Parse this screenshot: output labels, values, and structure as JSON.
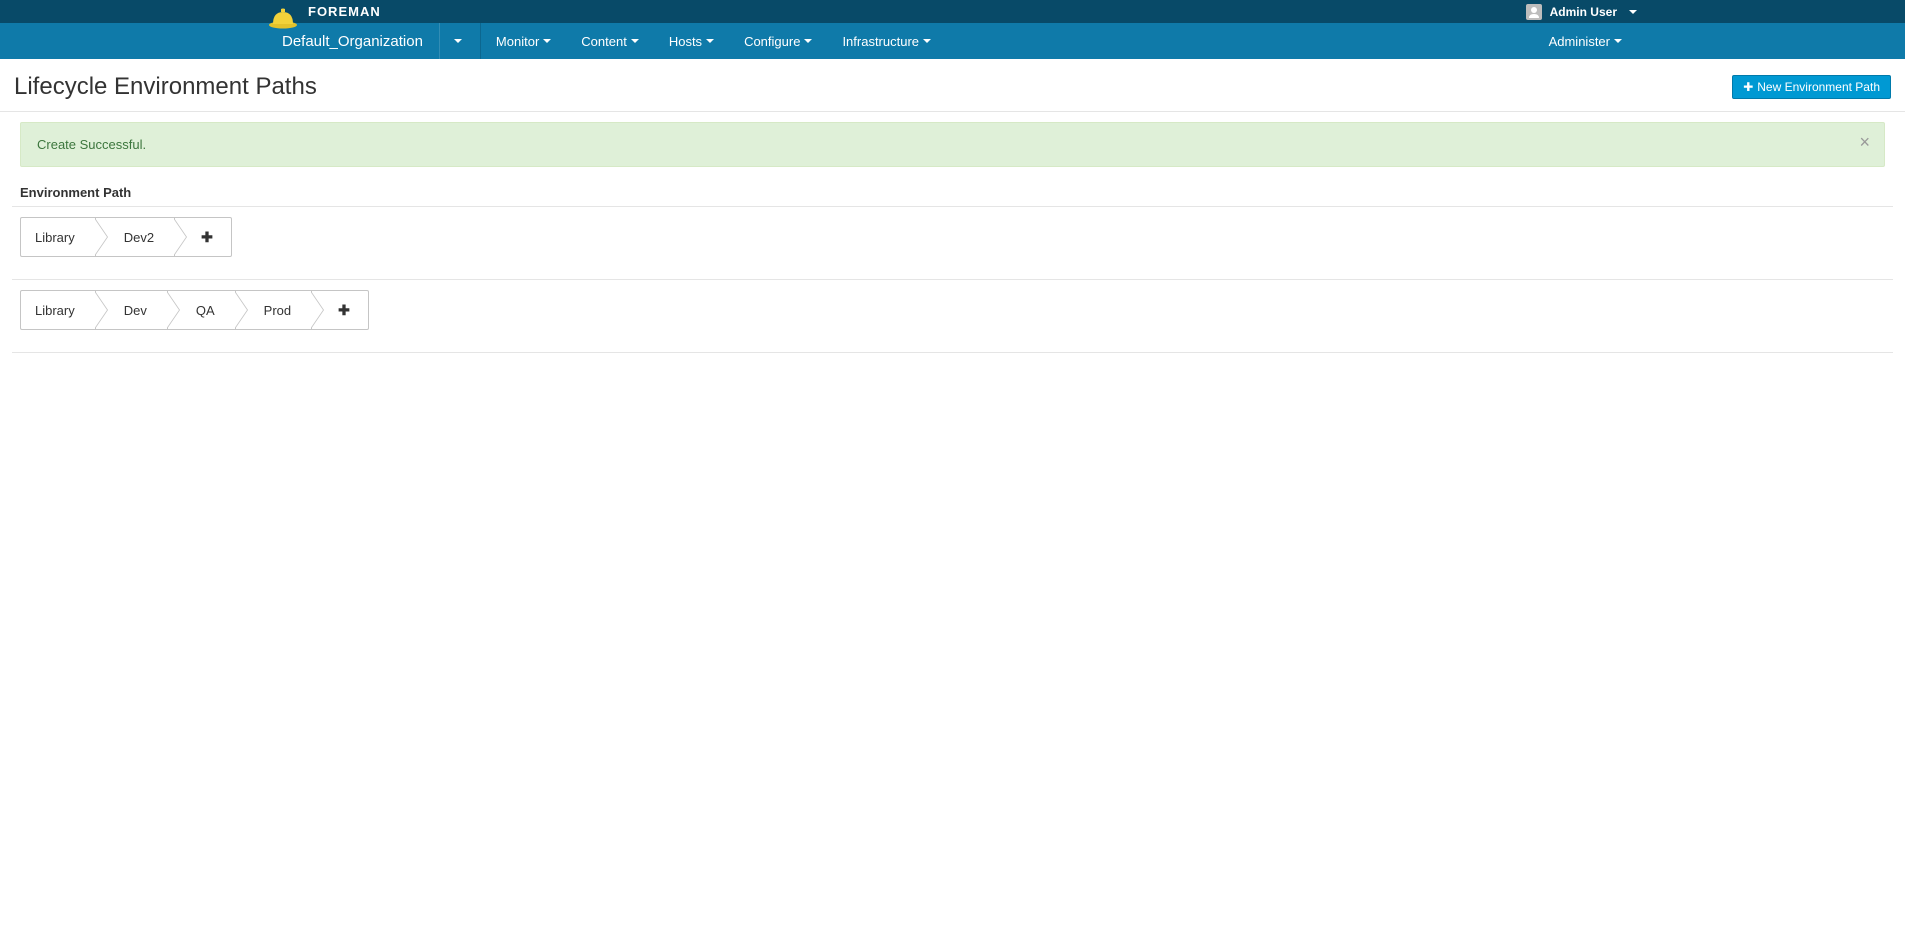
{
  "header": {
    "brand": "FOREMAN",
    "user_label": "Admin User"
  },
  "nav": {
    "org": "Default_Organization",
    "items": [
      "Monitor",
      "Content",
      "Hosts",
      "Configure",
      "Infrastructure"
    ],
    "right": "Administer"
  },
  "page": {
    "title": "Lifecycle Environment Paths",
    "new_button": "New Environment Path"
  },
  "alert": {
    "message": "Create Successful."
  },
  "section": {
    "label": "Environment Path"
  },
  "paths": [
    {
      "items": [
        "Library",
        "Dev2"
      ]
    },
    {
      "items": [
        "Library",
        "Dev",
        "QA",
        "Prod"
      ]
    }
  ]
}
